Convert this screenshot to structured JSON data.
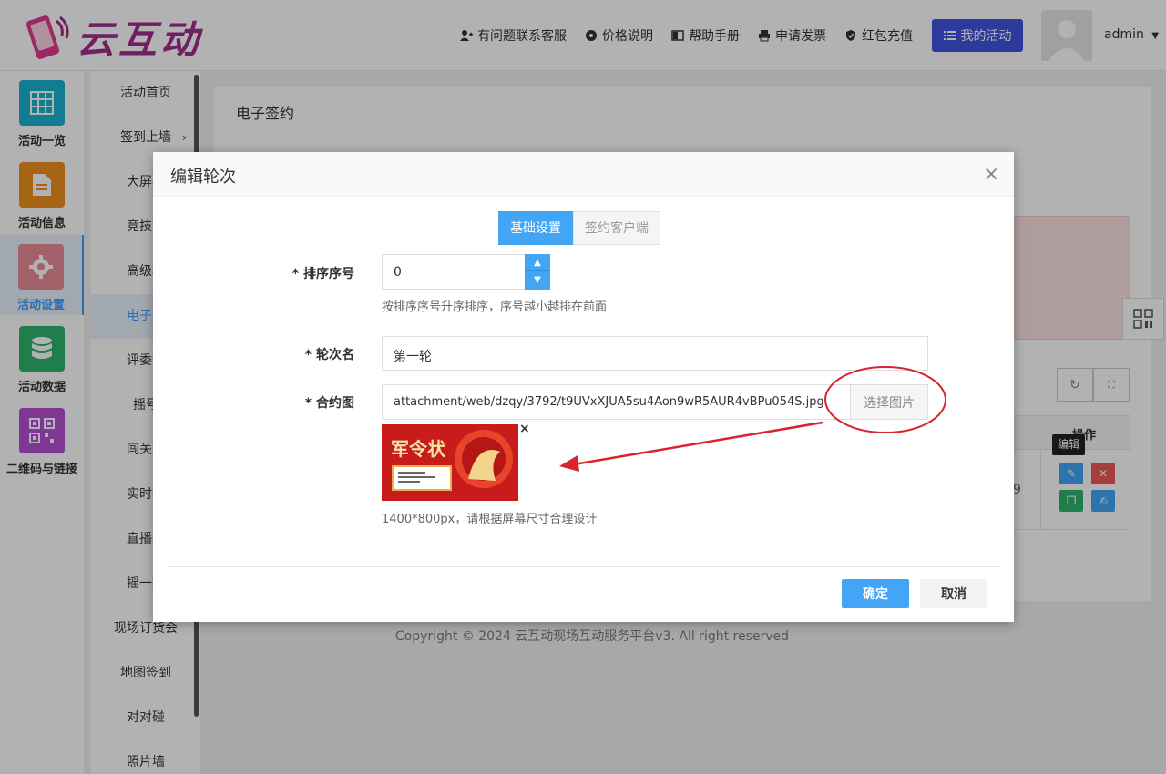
{
  "header": {
    "logo_text": "云互动",
    "nav": [
      {
        "label": "有问题联系客服",
        "icon": "user-plus-icon"
      },
      {
        "label": "价格说明",
        "icon": "gear-badge-icon"
      },
      {
        "label": "帮助手册",
        "icon": "book-icon"
      },
      {
        "label": "申请发票",
        "icon": "printer-icon"
      },
      {
        "label": "红包充值",
        "icon": "shield-check-icon"
      }
    ],
    "my_activity": "我的活动",
    "user": "admin"
  },
  "sidebar": {
    "items": [
      {
        "label": "活动一览",
        "icon": "grid-icon",
        "color": "#1ab2d2"
      },
      {
        "label": "活动信息",
        "icon": "document-icon",
        "color": "#f0901d"
      },
      {
        "label": "活动设置",
        "icon": "gear-icon",
        "color": "#e88a95"
      },
      {
        "label": "活动数据",
        "icon": "database-icon",
        "color": "#2fb56f"
      },
      {
        "label": "二维码与链接",
        "icon": "qrcode-icon",
        "color": "#b84fd4"
      }
    ]
  },
  "submenu": {
    "items": [
      "活动首页",
      "签到上墙",
      "大屏抽",
      "竞技游",
      "高级功",
      "电子签",
      "评委评",
      "摇号",
      "闯关答",
      "实时投",
      "直播互",
      "摇一摇",
      "现场订货会",
      "地图签到",
      "对对碰",
      "照片墙"
    ]
  },
  "content": {
    "title": "电子签约",
    "table_op_header": "操作",
    "tooltip": "编辑",
    "partial_cell": "9",
    "copyright": "Copyright © 2024 云互动现场互动服务平台v3. All right reserved"
  },
  "modal": {
    "title": "编辑轮次",
    "close": "×",
    "tabs": [
      "基础设置",
      "签约客户端"
    ],
    "sort_label": "* 排序序号",
    "sort_value": "0",
    "sort_help": "按排序序号升序排序，序号越小越排在前面",
    "round_label": "* 轮次名",
    "round_value": "第一轮",
    "contract_label": "* 合约图",
    "contract_path": "attachment/web/dzqy/3792/t9UVxXJUA5su4Aon9wR5AUR4vBPu054S.jpg",
    "pick_button": "选择图片",
    "thumb_title": "军令状",
    "remove": "×",
    "image_help": "1400*800px，请根据屏幕尺寸合理设计",
    "ok": "确定",
    "cancel": "取消"
  },
  "colors": {
    "primary": "#42a5f5",
    "nav_button": "#4053e0",
    "brand": "#a12d8f",
    "annotation": "#d9232d"
  }
}
